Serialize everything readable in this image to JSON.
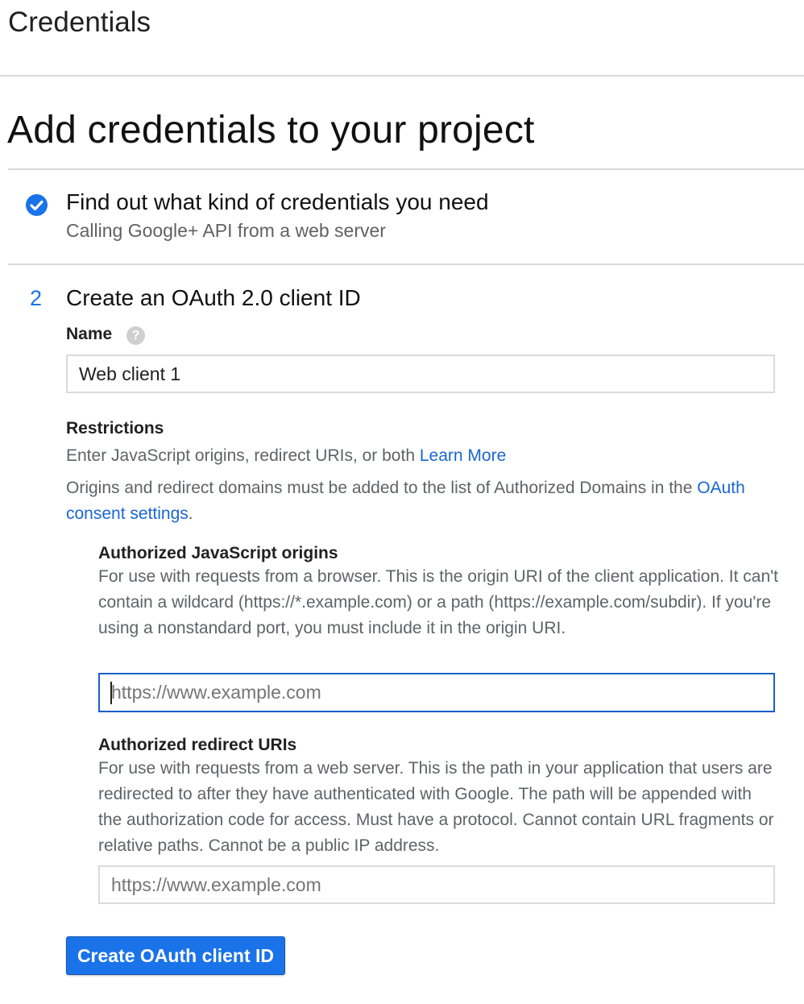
{
  "header": {
    "title": "Credentials"
  },
  "page": {
    "title": "Add credentials to your project"
  },
  "step1": {
    "status_icon": "check-circle-icon",
    "title": "Find out what kind of credentials you need",
    "subtitle": "Calling Google+ API from a web server"
  },
  "step2": {
    "number": "2",
    "title": "Create an OAuth 2.0 client ID",
    "name_label": "Name",
    "help_icon": "help-icon",
    "help_glyph": "?",
    "name_value": "Web client 1",
    "restrictions": {
      "heading": "Restrictions",
      "description": "Enter JavaScript origins, redirect URIs, or both",
      "learn_more": "Learn More",
      "domains_note": "Origins and redirect domains must be added to the list of Authorized Domains in the",
      "consent_link": "OAuth consent settings",
      "consent_suffix": "."
    },
    "js_origins": {
      "heading": "Authorized JavaScript origins",
      "description": "For use with requests from a browser. This is the origin URI of the client application. It can't contain a wildcard (https://*.example.com) or a path (https://example.com/subdir). If you're using a nonstandard port, you must include it in the origin URI.",
      "placeholder": "https://www.example.com",
      "value": ""
    },
    "redirect_uris": {
      "heading": "Authorized redirect URIs",
      "description": "For use with requests from a web server. This is the path in your application that users are redirected to after they have authenticated with Google. The path will be appended with the authorization code for access. Must have a protocol. Cannot contain URL fragments or relative paths. Cannot be a public IP address.",
      "placeholder": "https://www.example.com",
      "value": ""
    },
    "create_button": "Create OAuth client ID"
  },
  "colors": {
    "accent": "#1a73e8",
    "link": "#1a67d2",
    "divider": "#d9d9d9",
    "focus_border": "#1a5fc8"
  }
}
